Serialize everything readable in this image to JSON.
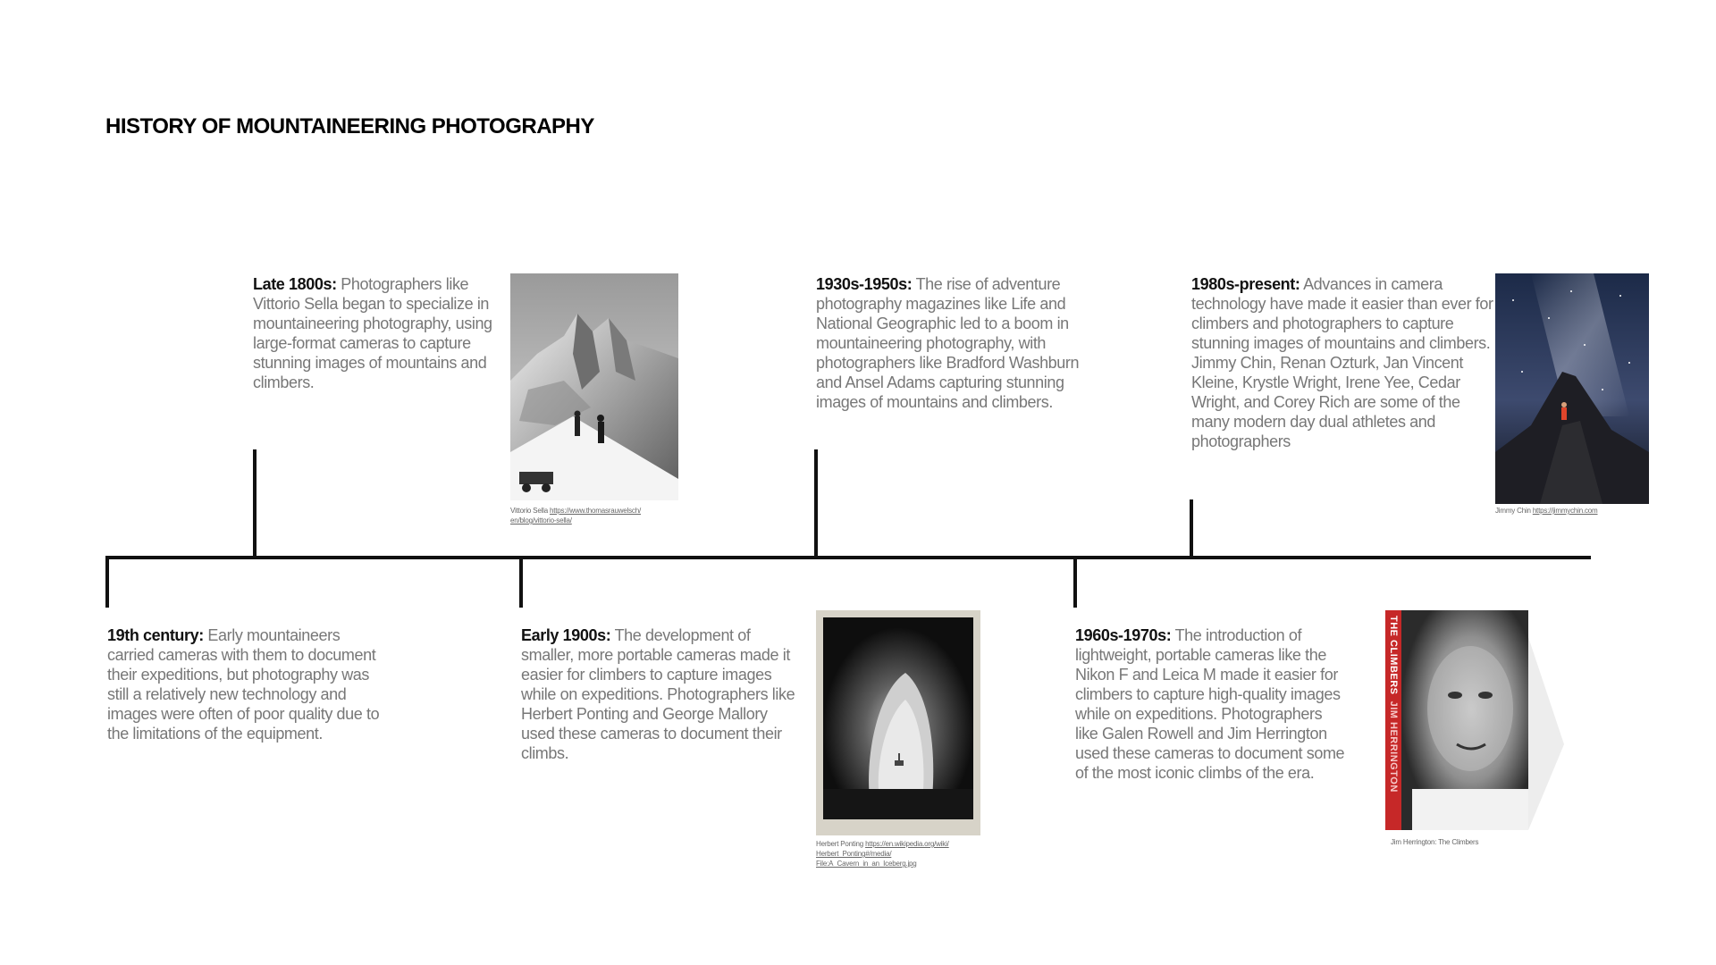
{
  "page": {
    "title": "HISTORY OF MOUNTAINEERING PHOTOGRAPHY"
  },
  "entries": [
    {
      "era": "Late 1800s:",
      "text": " Photographers like Vittorio Sella began to specialize in mountaineering photography, using large-format cameras to capture stunning images of mountains and climbers."
    },
    {
      "era": "19th century:",
      "text": " Early mountaineers carried cameras with them to document their expeditions, but photography was still a relatively new technology and images were often of poor quality due to the limitations of the equipment."
    },
    {
      "era": "Early 1900s:",
      "text": " The development of smaller, more portable cameras made it easier for climbers to capture images while on expeditions. Photographers like Herbert Ponting and George Mallory used these cameras to document their climbs."
    },
    {
      "era": "1930s-1950s:",
      "text": " The rise of adventure photography magazines like Life and National Geographic led to a boom in mountaineering photography, with photographers like Bradford Washburn and Ansel Adams capturing stunning images of mountains and climbers."
    },
    {
      "era": "1960s-1970s:",
      "text": " The introduction of lightweight, portable cameras like the Nikon F and Leica M made it easier for climbers to capture high-quality images while on expeditions. Photographers like Galen Rowell and Jim Herrington used these cameras to document some of the most iconic climbs of the era."
    },
    {
      "era": "1980s-present:",
      "text": " Advances in camera technology have made it easier than ever for climbers and photographers to capture stunning images of mountains and climbers. Jimmy Chin, Renan Ozturk, Jan Vincent Kleine, Krystle Wright, Irene Yee, Cedar Wright, and Corey Rich are some of the many modern day dual athletes and photographers"
    }
  ],
  "credits": {
    "sella": {
      "name": "Vittorio Sella ",
      "link1": "https://www.thomasrauwelsch/",
      "link2": "en/blog/vittorio-sella/"
    },
    "ponting": {
      "name": "Herbert Ponting ",
      "link1": "https://en.wikipedia.org/wiki/",
      "link2": "Herbert_Ponting#/media/",
      "link3": "File:A_Cavern_in_an_Iceberg.jpg"
    },
    "chin": {
      "name": "Jimmy Chin ",
      "link": "https://jimmychin.com"
    },
    "herrington": {
      "name": "Jim Herrington: The Climbers"
    }
  },
  "book": {
    "spine_title": "THE CLIMBERS",
    "spine_author": "JIM HERRINGTON"
  },
  "colors": {
    "axis": "#111111",
    "book_spine": "#c62828"
  }
}
